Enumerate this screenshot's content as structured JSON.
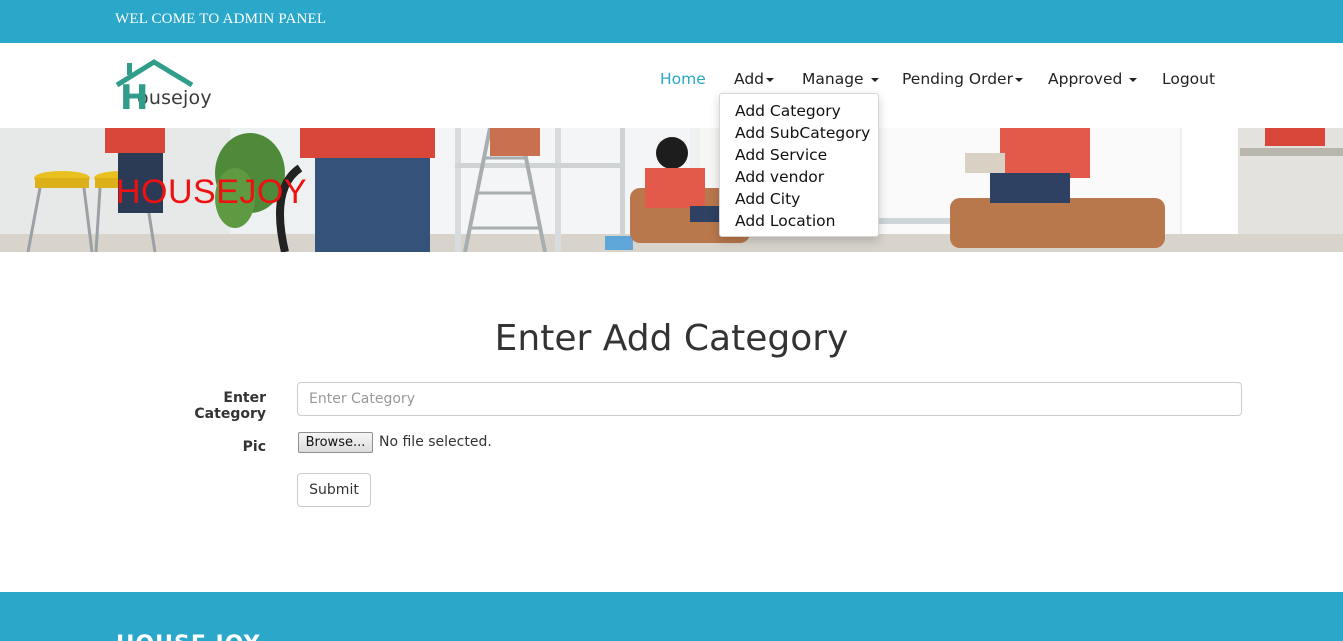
{
  "topbar": {
    "text": "WEL COME TO ADMIN PANEL"
  },
  "logo": {
    "letter": "H",
    "rest": "ousejoy",
    "icon": "house-roof-icon"
  },
  "nav": {
    "home": "Home",
    "add": "Add",
    "manage": "Manage",
    "pending": "Pending Order",
    "approved": "Approved",
    "logout": "Logout"
  },
  "dropdown": {
    "items": [
      "Add Category",
      "Add SubCategory",
      "Add Service",
      "Add vendor",
      "Add City",
      "Add Location"
    ]
  },
  "banner": {
    "title": "HOUSEJOY"
  },
  "form": {
    "heading": "Enter Add Category",
    "category_label": "Enter Category",
    "category_placeholder": "Enter Category",
    "category_value": "",
    "pic_label": "Pic",
    "browse_label": "Browse...",
    "file_status": "No file selected.",
    "submit_label": "Submit"
  },
  "footer": {
    "title": "HOUSE JOY"
  },
  "colors": {
    "accent": "#2aa7c9",
    "banner_title": "#ee1111",
    "logo_green": "#2f9d8a"
  }
}
